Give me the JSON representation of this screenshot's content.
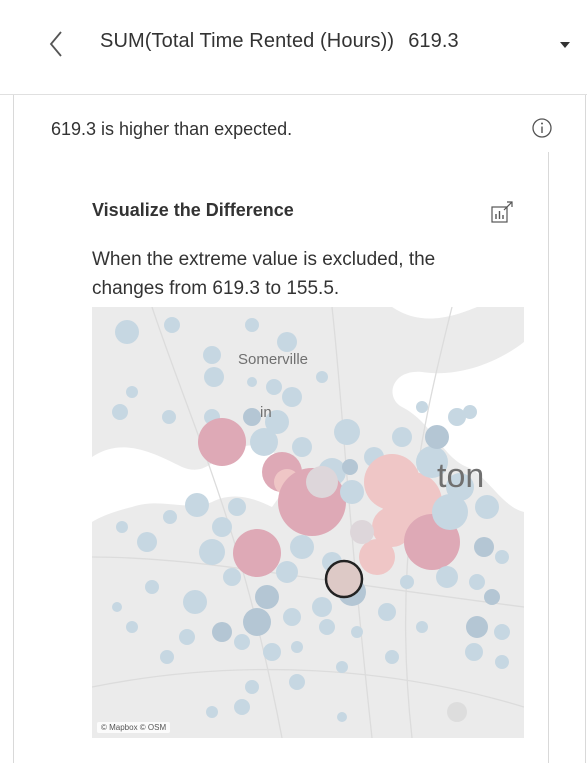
{
  "header": {
    "back_icon": "chevron-left-icon",
    "title": "SUM(Total Time Rented (Hours))",
    "value": "619.3",
    "dropdown_icon": "caret-down-icon"
  },
  "explanation": {
    "statement": "619.3 is higher than expected.",
    "info_icon": "info-circle-icon"
  },
  "card": {
    "title": "Visualize the Difference",
    "expand_icon": "open-external-chart-icon",
    "description": "When the extreme value is excluded, the changes from 619.3 to 155.5."
  },
  "map": {
    "labels": {
      "somerville": "Somerville",
      "partial_label_1": "in",
      "partial_label_2": "ton"
    },
    "attribution": "© Mapbox © OSM",
    "colors": {
      "background": "#ebebeb",
      "water": "#ffffff",
      "light_blue": "#c6d7e2",
      "blue_gray": "#b4c6d4",
      "light_pink": "#efc6c6",
      "medium_pink": "#dea9b6",
      "dark_pink": "#d48f9f",
      "highlighted_mark": "#ddc9c6"
    }
  }
}
